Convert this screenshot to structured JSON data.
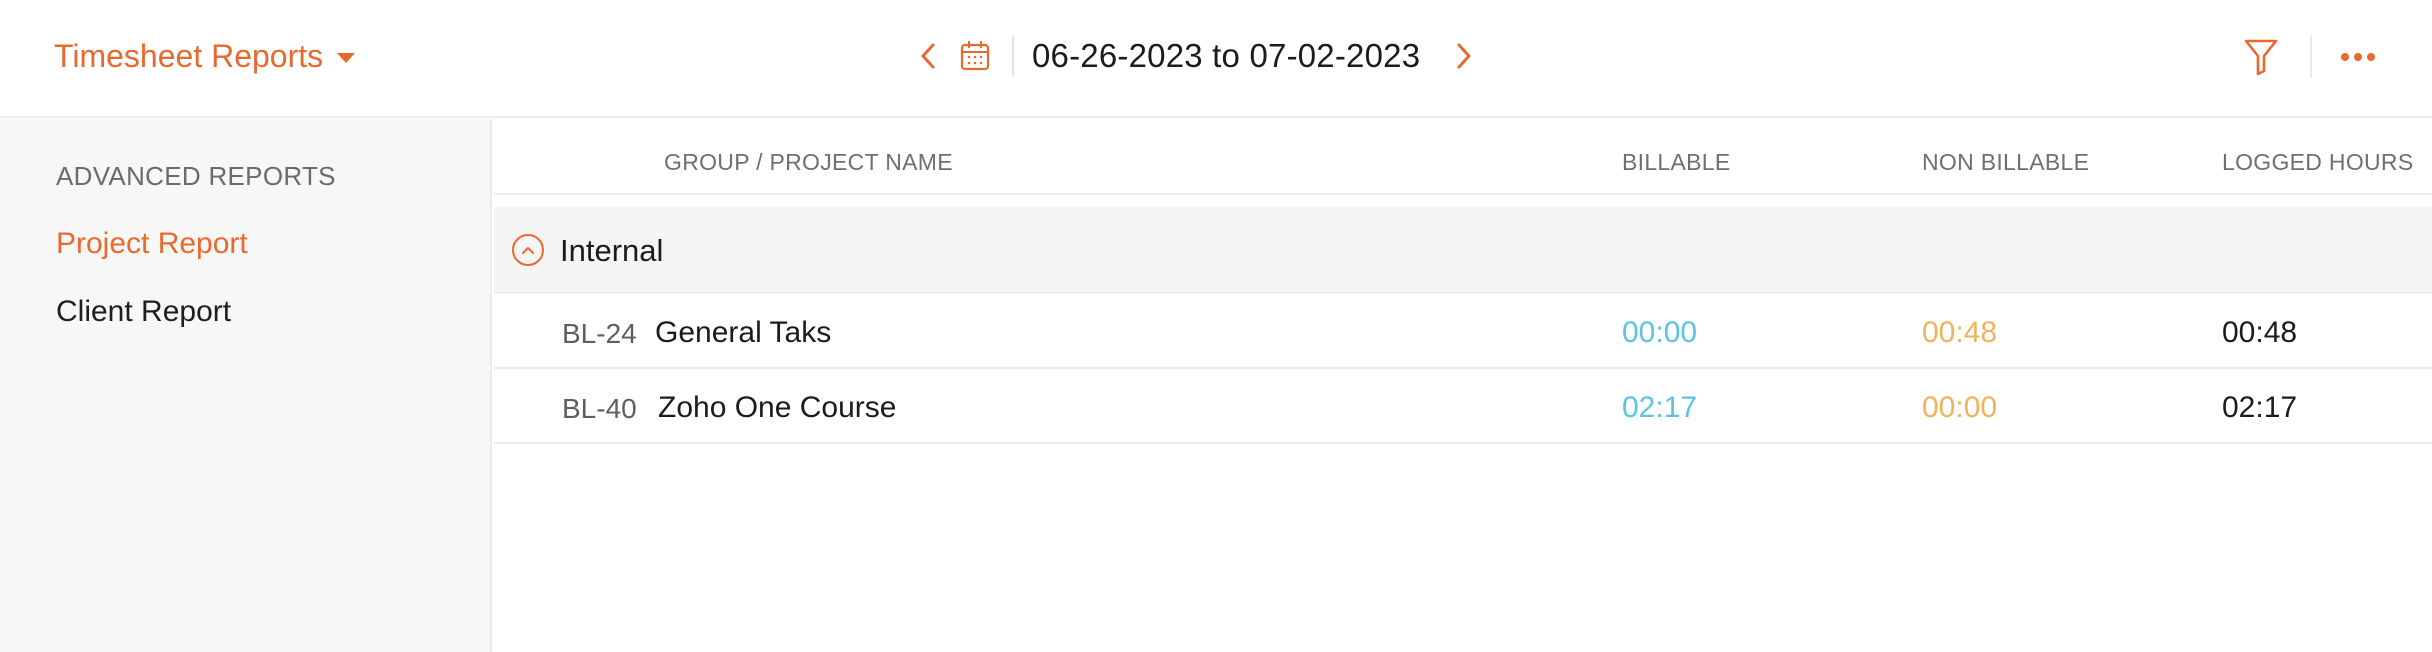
{
  "header": {
    "report_title": "Timesheet Reports",
    "date_range": "06-26-2023 to 07-02-2023",
    "icons": {
      "caret": "caret-down-icon",
      "prev": "chevron-left-icon",
      "calendar": "calendar-icon",
      "next": "chevron-right-icon",
      "filter": "filter-icon",
      "more": "more-horizontal-icon"
    }
  },
  "sidebar": {
    "heading": "ADVANCED REPORTS",
    "items": [
      {
        "label": "Project Report",
        "active": true
      },
      {
        "label": "Client Report",
        "active": false
      }
    ]
  },
  "table": {
    "columns": {
      "name": "GROUP / PROJECT NAME",
      "billable": "BILLABLE",
      "non_billable": "NON BILLABLE",
      "logged": "LOGGED HOURS"
    },
    "group": {
      "name": "Internal",
      "expanded": true
    },
    "rows": [
      {
        "code": "BL-24",
        "name": "General Taks",
        "billable": "00:00",
        "non_billable": "00:48",
        "logged": "00:48"
      },
      {
        "code": "BL-40",
        "name": "Zoho One Course",
        "billable": "02:17",
        "non_billable": "00:00",
        "logged": "02:17"
      }
    ]
  },
  "colors": {
    "accent": "#e8692e",
    "billable": "#5bc4e3",
    "non_billable": "#f1b25d",
    "sidebar_bg": "#f7f7f7",
    "group_bg": "#f5f5f5"
  }
}
